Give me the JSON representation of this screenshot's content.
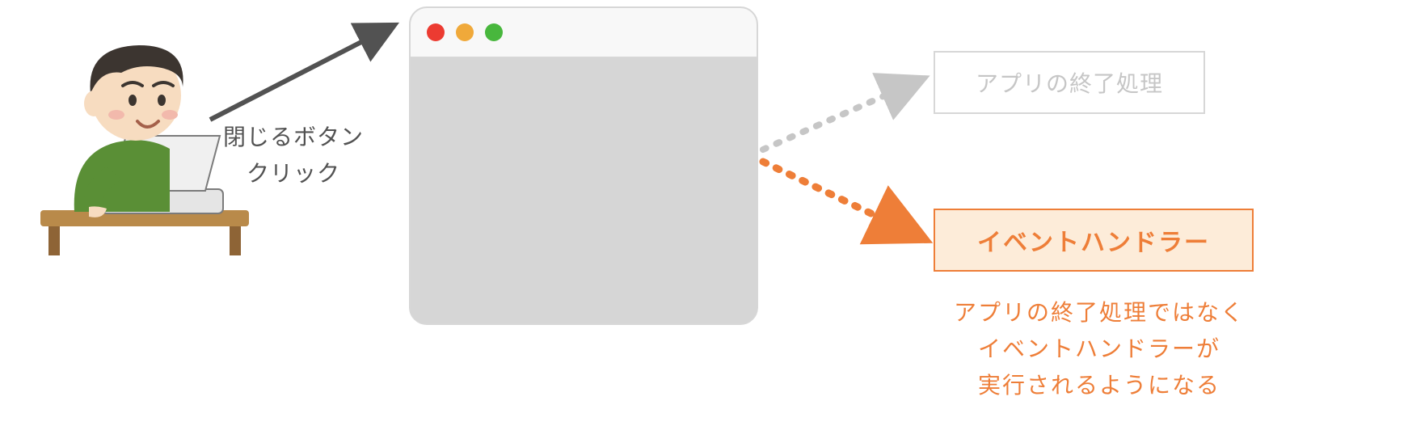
{
  "click_label_line1": "閉じるボタン",
  "click_label_line2": "クリック",
  "box_gray_label": "アプリの終了処理",
  "box_orange_label": "イベントハンドラー",
  "caption_line1": "アプリの終了処理ではなく",
  "caption_line2": "イベントハンドラーが",
  "caption_line3": "実行されるようになる"
}
